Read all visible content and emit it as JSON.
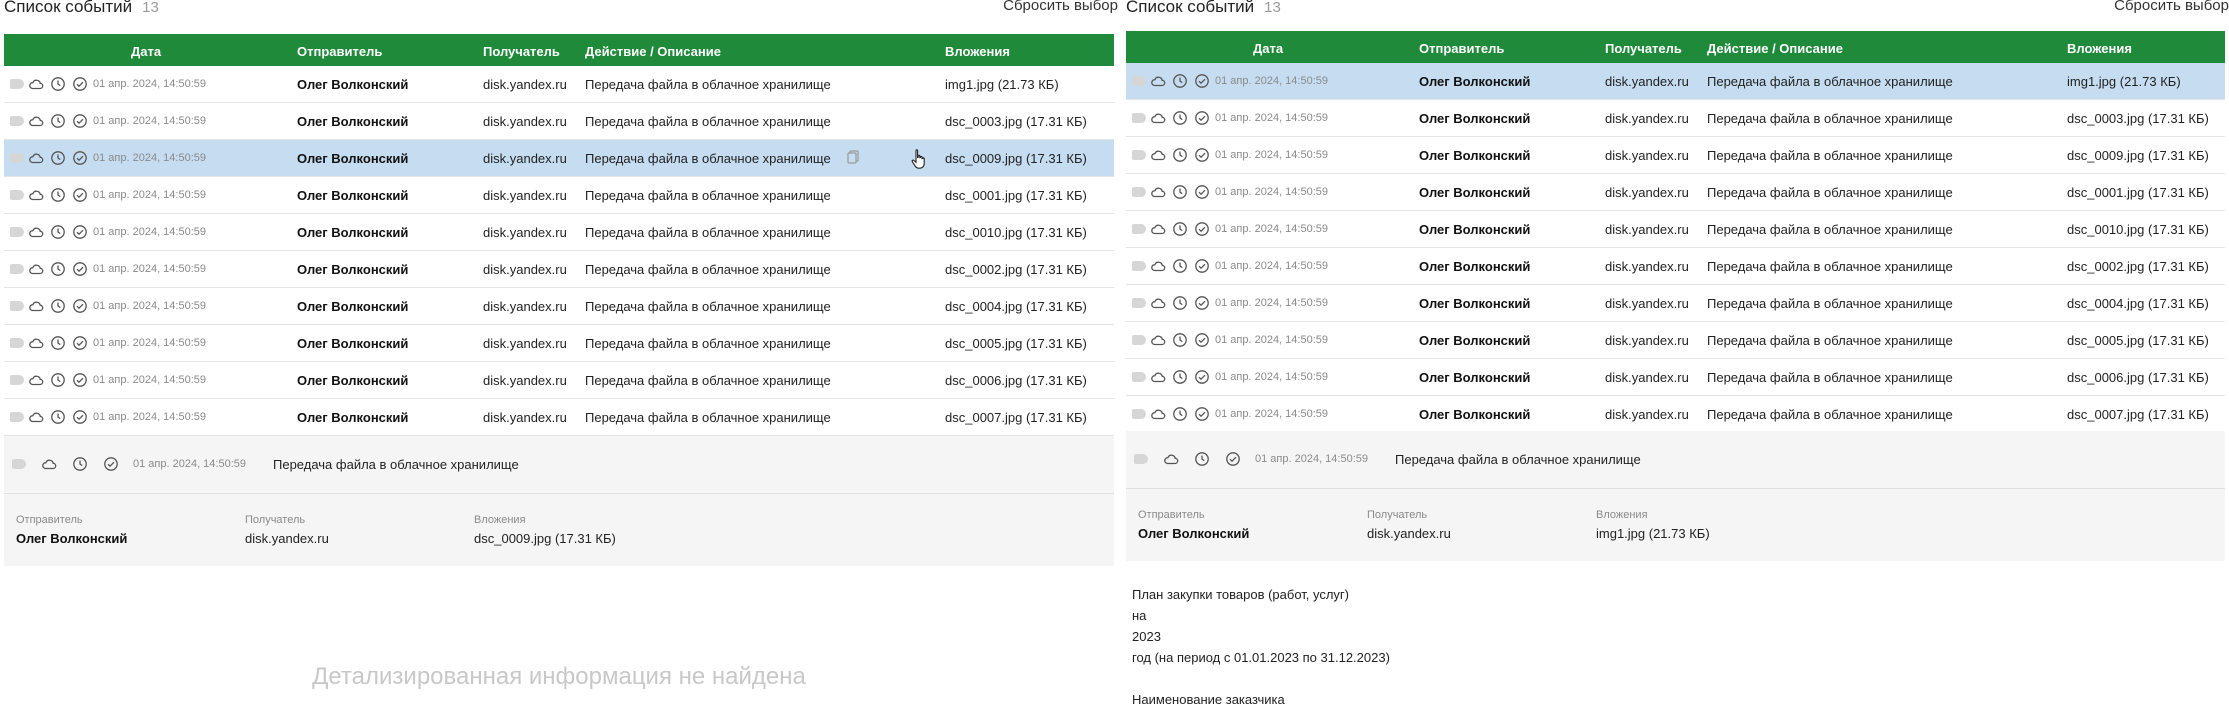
{
  "left": {
    "title": "Список событий",
    "count": "13",
    "reset": "Сбросить выбор",
    "columns": {
      "date": "Дата",
      "sender": "Отправитель",
      "recipient": "Получатель",
      "action": "Действие / Описание",
      "attachments": "Вложения"
    },
    "rows": [
      {
        "date": "01 апр. 2024, 14:50:59",
        "sender": "Олег Волконский",
        "recipient": "disk.yandex.ru",
        "action": "Передача файла в облачное хранилище",
        "attachment": "img1.jpg (21.73 КБ)"
      },
      {
        "date": "01 апр. 2024, 14:50:59",
        "sender": "Олег Волконский",
        "recipient": "disk.yandex.ru",
        "action": "Передача файла в облачное хранилище",
        "attachment": "dsc_0003.jpg (17.31 КБ)"
      },
      {
        "date": "01 апр. 2024, 14:50:59",
        "sender": "Олег Волконский",
        "recipient": "disk.yandex.ru",
        "action": "Передача файла в облачное хранилище",
        "attachment": "dsc_0009.jpg (17.31 КБ)"
      },
      {
        "date": "01 апр. 2024, 14:50:59",
        "sender": "Олег Волконский",
        "recipient": "disk.yandex.ru",
        "action": "Передача файла в облачное хранилище",
        "attachment": "dsc_0001.jpg (17.31 КБ)"
      },
      {
        "date": "01 апр. 2024, 14:50:59",
        "sender": "Олег Волконский",
        "recipient": "disk.yandex.ru",
        "action": "Передача файла в облачное хранилище",
        "attachment": "dsc_0010.jpg (17.31 КБ)"
      },
      {
        "date": "01 апр. 2024, 14:50:59",
        "sender": "Олег Волконский",
        "recipient": "disk.yandex.ru",
        "action": "Передача файла в облачное хранилище",
        "attachment": "dsc_0002.jpg (17.31 КБ)"
      },
      {
        "date": "01 апр. 2024, 14:50:59",
        "sender": "Олег Волконский",
        "recipient": "disk.yandex.ru",
        "action": "Передача файла в облачное хранилище",
        "attachment": "dsc_0004.jpg (17.31 КБ)"
      },
      {
        "date": "01 апр. 2024, 14:50:59",
        "sender": "Олег Волконский",
        "recipient": "disk.yandex.ru",
        "action": "Передача файла в облачное хранилище",
        "attachment": "dsc_0005.jpg (17.31 КБ)"
      },
      {
        "date": "01 апр. 2024, 14:50:59",
        "sender": "Олег Волконский",
        "recipient": "disk.yandex.ru",
        "action": "Передача файла в облачное хранилище",
        "attachment": "dsc_0006.jpg (17.31 КБ)"
      },
      {
        "date": "01 апр. 2024, 14:50:59",
        "sender": "Олег Волконский",
        "recipient": "disk.yandex.ru",
        "action": "Передача файла в облачное хранилище",
        "attachment": "dsc_0007.jpg (17.31 КБ)"
      }
    ],
    "detail": {
      "date": "01 апр. 2024, 14:50:59",
      "action": "Передача файла в облачное хранилище",
      "sender_label": "Отправитель",
      "sender": "Олег Волконский",
      "recipient_label": "Получатель",
      "recipient": "disk.yandex.ru",
      "attachments_label": "Вложения",
      "attachment": "dsc_0009.jpg (17.31 КБ)"
    },
    "not_found": "Детализированная информация не найдена"
  },
  "right": {
    "title": "Список событий",
    "count": "13",
    "reset": "Сбросить выбор",
    "columns": {
      "date": "Дата",
      "sender": "Отправитель",
      "recipient": "Получатель",
      "action": "Действие / Описание",
      "attachments": "Вложения"
    },
    "rows": [
      {
        "date": "01 апр. 2024, 14:50:59",
        "sender": "Олег Волконский",
        "recipient": "disk.yandex.ru",
        "action": "Передача файла в облачное хранилище",
        "attachment": "img1.jpg (21.73 КБ)"
      },
      {
        "date": "01 апр. 2024, 14:50:59",
        "sender": "Олег Волконский",
        "recipient": "disk.yandex.ru",
        "action": "Передача файла в облачное хранилище",
        "attachment": "dsc_0003.jpg (17.31 КБ)"
      },
      {
        "date": "01 апр. 2024, 14:50:59",
        "sender": "Олег Волконский",
        "recipient": "disk.yandex.ru",
        "action": "Передача файла в облачное хранилище",
        "attachment": "dsc_0009.jpg (17.31 КБ)"
      },
      {
        "date": "01 апр. 2024, 14:50:59",
        "sender": "Олег Волконский",
        "recipient": "disk.yandex.ru",
        "action": "Передача файла в облачное хранилище",
        "attachment": "dsc_0001.jpg (17.31 КБ)"
      },
      {
        "date": "01 апр. 2024, 14:50:59",
        "sender": "Олег Волконский",
        "recipient": "disk.yandex.ru",
        "action": "Передача файла в облачное хранилище",
        "attachment": "dsc_0010.jpg (17.31 КБ)"
      },
      {
        "date": "01 апр. 2024, 14:50:59",
        "sender": "Олег Волконский",
        "recipient": "disk.yandex.ru",
        "action": "Передача файла в облачное хранилище",
        "attachment": "dsc_0002.jpg (17.31 КБ)"
      },
      {
        "date": "01 апр. 2024, 14:50:59",
        "sender": "Олег Волконский",
        "recipient": "disk.yandex.ru",
        "action": "Передача файла в облачное хранилище",
        "attachment": "dsc_0004.jpg (17.31 КБ)"
      },
      {
        "date": "01 апр. 2024, 14:50:59",
        "sender": "Олег Волконский",
        "recipient": "disk.yandex.ru",
        "action": "Передача файла в облачное хранилище",
        "attachment": "dsc_0005.jpg (17.31 КБ)"
      },
      {
        "date": "01 апр. 2024, 14:50:59",
        "sender": "Олег Волконский",
        "recipient": "disk.yandex.ru",
        "action": "Передача файла в облачное хранилище",
        "attachment": "dsc_0006.jpg (17.31 КБ)"
      },
      {
        "date": "01 апр. 2024, 14:50:59",
        "sender": "Олег Волконский",
        "recipient": "disk.yandex.ru",
        "action": "Передача файла в облачное хранилище",
        "attachment": "dsc_0007.jpg (17.31 КБ)"
      }
    ],
    "detail": {
      "date": "01 апр. 2024, 14:50:59",
      "action": "Передача файла в облачное хранилище",
      "sender_label": "Отправитель",
      "sender": "Олег Волконский",
      "recipient_label": "Получатель",
      "recipient": "disk.yandex.ru",
      "attachments_label": "Вложения",
      "attachment": "img1.jpg (21.73 КБ)"
    },
    "document_lines": [
      "План закупки товаров (работ, услуг)",
      "на",
      "2023",
      "год (на период с 01.01.2023 по 31.12.2023)",
      "",
      "Наименование заказчика"
    ]
  },
  "icons": [
    "tag-icon",
    "cloud-icon",
    "clock-icon",
    "check-circle-icon",
    "copy-icon",
    "hand-cursor-icon"
  ],
  "colors": {
    "header_green": "#1f8b3a",
    "selected_row": "#c5dcf1"
  }
}
